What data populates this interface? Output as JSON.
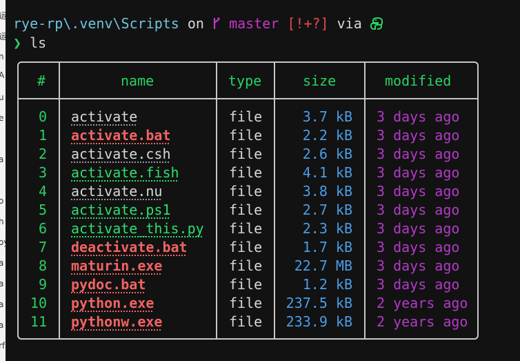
{
  "prompt": {
    "path": "rye-rp\\.venv\\Scripts",
    "on_word": "on",
    "branch_icon": "git-branch-icon",
    "branch": "master",
    "status": "[!+?]",
    "via_word": "via",
    "python_icon": "python-icon"
  },
  "command": {
    "caret": "❯",
    "text": "ls"
  },
  "table": {
    "headers": {
      "index": "#",
      "name": "name",
      "type": "type",
      "size": "size",
      "modified": "modified"
    },
    "rows": [
      {
        "index": "0",
        "name": "activate",
        "style": "plain",
        "type": "file",
        "size": "3.7 kB",
        "modified": "3 days ago"
      },
      {
        "index": "1",
        "name": "activate.bat",
        "style": "red",
        "type": "file",
        "size": "2.2 kB",
        "modified": "3 days ago"
      },
      {
        "index": "2",
        "name": "activate.csh",
        "style": "plain",
        "type": "file",
        "size": "2.6 kB",
        "modified": "3 days ago"
      },
      {
        "index": "3",
        "name": "activate.fish",
        "style": "green",
        "type": "file",
        "size": "4.1 kB",
        "modified": "3 days ago"
      },
      {
        "index": "4",
        "name": "activate.nu",
        "style": "plain",
        "type": "file",
        "size": "3.8 kB",
        "modified": "3 days ago"
      },
      {
        "index": "5",
        "name": "activate.ps1",
        "style": "green",
        "type": "file",
        "size": "2.7 kB",
        "modified": "3 days ago"
      },
      {
        "index": "6",
        "name": "activate_this.py",
        "style": "green",
        "type": "file",
        "size": "2.3 kB",
        "modified": "3 days ago"
      },
      {
        "index": "7",
        "name": "deactivate.bat",
        "style": "red",
        "type": "file",
        "size": "1.7 kB",
        "modified": "3 days ago"
      },
      {
        "index": "8",
        "name": "maturin.exe",
        "style": "red",
        "type": "file",
        "size": "22.7 MB",
        "modified": "3 days ago"
      },
      {
        "index": "9",
        "name": "pydoc.bat",
        "style": "red",
        "type": "file",
        "size": "1.2 kB",
        "modified": "3 days ago"
      },
      {
        "index": "10",
        "name": "python.exe",
        "style": "red",
        "type": "file",
        "size": "237.5 kB",
        "modified": "2 years ago"
      },
      {
        "index": "11",
        "name": "pythonw.exe",
        "style": "red",
        "type": "file",
        "size": "233.9 kB",
        "modified": "2 years ago"
      }
    ]
  }
}
